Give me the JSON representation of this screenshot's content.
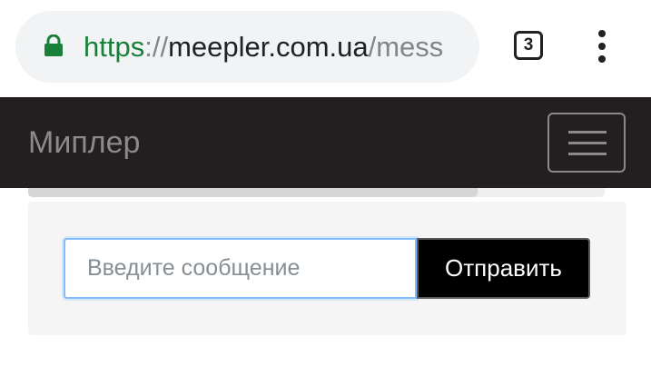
{
  "browser": {
    "url": {
      "scheme": "https",
      "separator": "://",
      "host": "meepler.com.ua",
      "path": "/mess"
    },
    "tab_count": "3",
    "secure_icon": "lock-icon",
    "menu_icon": "kebab-menu-icon"
  },
  "navbar": {
    "brand": "Миплер",
    "toggler_icon": "hamburger-menu-icon"
  },
  "progress": {
    "fraction": 0.78
  },
  "composer": {
    "placeholder": "Введите сообщение",
    "value": "",
    "send_label": "Отправить"
  },
  "colors": {
    "navbar_bg": "#231f20",
    "secure_green": "#188038",
    "input_focus": "#80bdff",
    "send_bg": "#000000"
  }
}
